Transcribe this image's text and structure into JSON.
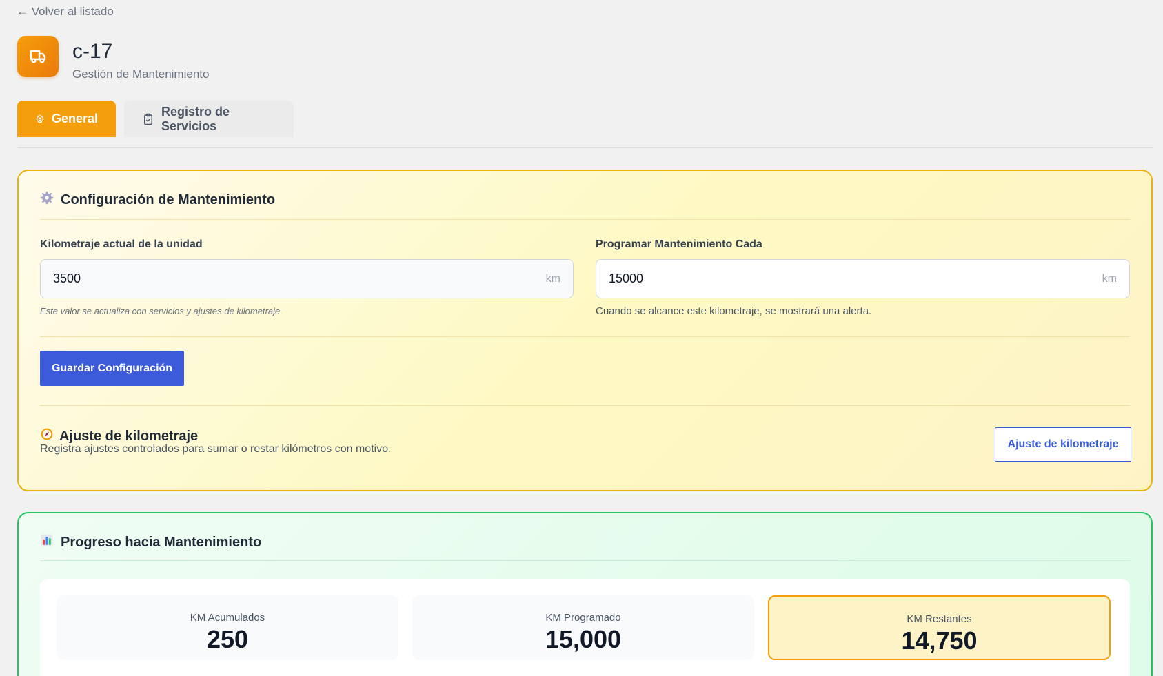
{
  "nav": {
    "back_label": "← Volver al listado"
  },
  "header": {
    "title": "c-17",
    "subtitle": "Gestión de Mantenimiento",
    "icon": "truck-icon",
    "accent_color": "#f59e0b"
  },
  "tabs": [
    {
      "label": "General",
      "icon": "gear-icon",
      "active": true
    },
    {
      "label": "Registro de Servicios",
      "icon": "clipboard-check-icon",
      "active": false
    }
  ],
  "config": {
    "heading": "Configuración de Mantenimiento",
    "heading_icon": "gear-emoji-icon",
    "current_km": {
      "label": "Kilometraje actual de la unidad",
      "value": "3500",
      "unit": "km",
      "help": "Este valor se actualiza con servicios y ajustes de kilometraje."
    },
    "schedule_km": {
      "label": "Programar Mantenimiento Cada",
      "value": "15000",
      "unit": "km",
      "help": "Cuando se alcance este kilometraje, se mostrará una alerta."
    },
    "save_label": "Guardar Configuración",
    "adjust": {
      "title": "Ajuste de kilometraje",
      "icon": "compass-icon",
      "description": "Registra ajustes controlados para sumar o restar kilómetros con motivo.",
      "button_label": "Ajuste de kilometraje"
    }
  },
  "progress": {
    "heading": "Progreso hacia Mantenimiento",
    "heading_icon": "bar-chart-icon",
    "stats": [
      {
        "label": "KM Acumulados",
        "value": "250"
      },
      {
        "label": "KM Programado",
        "value": "15,000"
      },
      {
        "label": "KM Restantes",
        "value": "14,750",
        "highlight": true
      }
    ]
  }
}
